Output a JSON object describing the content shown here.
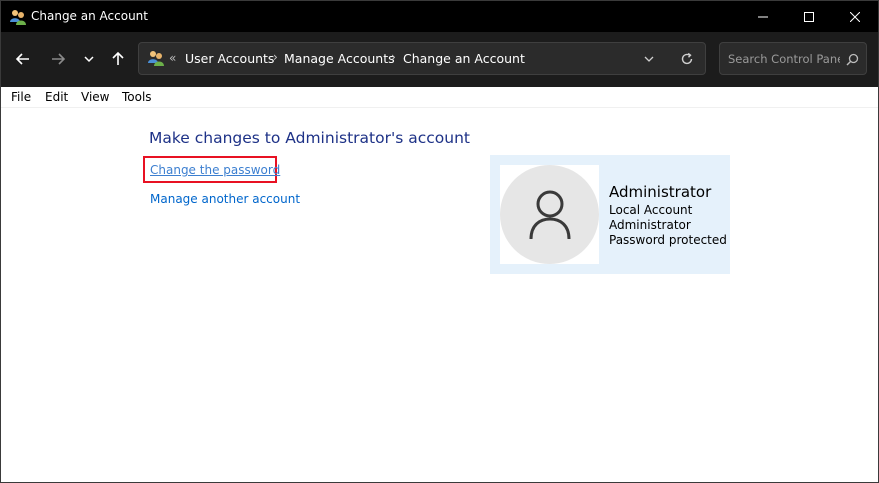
{
  "window": {
    "title": "Change an Account"
  },
  "navigation": {
    "back_icon": "arrow-left-icon",
    "forward_icon": "arrow-right-icon",
    "recent_icon": "chevron-down-icon",
    "up_icon": "arrow-up-icon"
  },
  "address": {
    "overflow": "«",
    "breadcrumbs": [
      "User Accounts",
      "Manage Accounts",
      "Change an Account"
    ]
  },
  "search": {
    "placeholder": "Search Control Panel",
    "value": ""
  },
  "menu": [
    "File",
    "Edit",
    "View",
    "Tools"
  ],
  "main": {
    "heading": "Make changes to Administrator's account",
    "links": {
      "change_password": "Change the password",
      "manage_another": "Manage another account"
    }
  },
  "account": {
    "name": "Administrator",
    "details": [
      "Local Account",
      "Administrator",
      "Password protected"
    ]
  },
  "colors": {
    "accent_link": "#0066cc",
    "heading": "#1e3287",
    "highlight": "#e81123",
    "card_bg": "#e5f1fb"
  }
}
